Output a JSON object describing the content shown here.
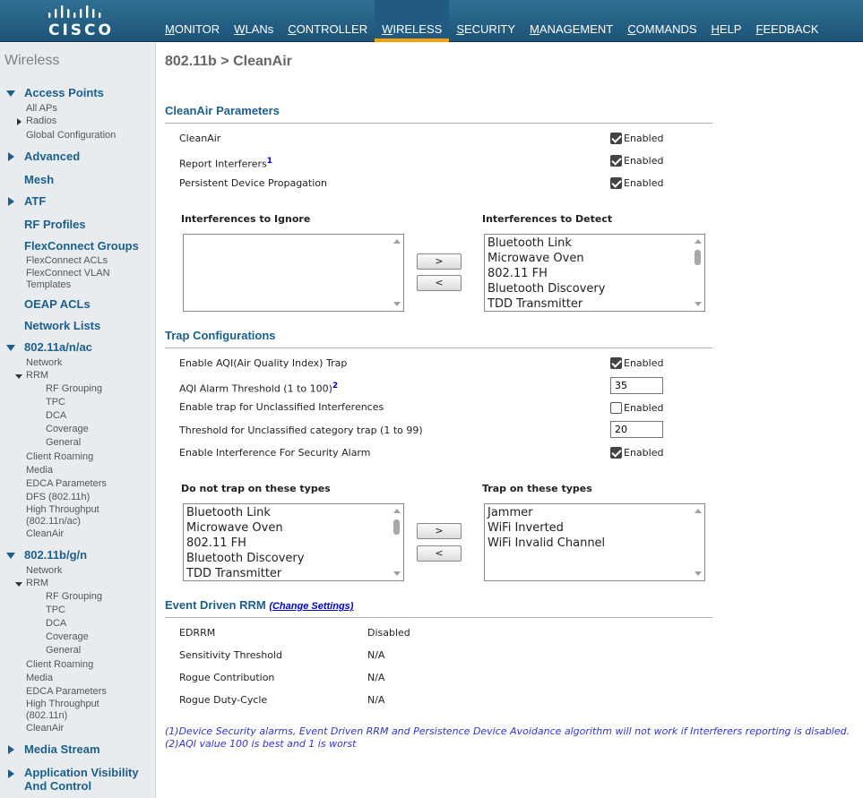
{
  "brand": {
    "logo_text": "CISCO"
  },
  "nav": [
    {
      "id": "monitor",
      "ul": "M",
      "rest": "ONITOR"
    },
    {
      "id": "wlans",
      "ul": "W",
      "rest": "LANs"
    },
    {
      "id": "controller",
      "ul": "C",
      "rest": "ONTROLLER"
    },
    {
      "id": "wireless",
      "ul": "W",
      "rest": "IRELESS"
    },
    {
      "id": "security",
      "ul": "S",
      "rest": "ECURITY"
    },
    {
      "id": "management",
      "ul": "M",
      "rest": "ANAGEMENT"
    },
    {
      "id": "commands",
      "ul": "C",
      "rest": "OMMANDS"
    },
    {
      "id": "help",
      "ul": "H",
      "rest": "ELP"
    },
    {
      "id": "feedback",
      "ul": "F",
      "rest": "EEDBACK"
    }
  ],
  "nav_active": "wireless",
  "sidebar": {
    "title": "Wireless",
    "access_points": "Access Points",
    "all_aps": "All APs",
    "radios": "Radios",
    "global_config": "Global Configuration",
    "advanced": "Advanced",
    "mesh": "Mesh",
    "atf": "ATF",
    "rf_profiles": "RF Profiles",
    "flexconnect_groups": "FlexConnect Groups",
    "flexconnect_acls": "FlexConnect ACLs",
    "flexconnect_vlan_1": "FlexConnect VLAN",
    "flexconnect_vlan_2": "Templates",
    "oeap_acls": "OEAP ACLs",
    "network_lists": "Network Lists",
    "a_band": "802.11a/n/ac",
    "a_network": "Network",
    "a_rrm": "RRM",
    "a_rf_grouping": "RF Grouping",
    "a_tpc": "TPC",
    "a_dca": "DCA",
    "a_coverage": "Coverage",
    "a_general": "General",
    "a_client_roaming": "Client Roaming",
    "a_media": "Media",
    "a_edca": "EDCA Parameters",
    "a_dfs": "DFS (802.11h)",
    "a_ht_1": "High Throughput",
    "a_ht_2": "(802.11n/ac)",
    "a_cleanair": "CleanAir",
    "b_band": "802.11b/g/n",
    "b_network": "Network",
    "b_rrm": "RRM",
    "b_rf_grouping": "RF Grouping",
    "b_tpc": "TPC",
    "b_dca": "DCA",
    "b_coverage": "Coverage",
    "b_general": "General",
    "b_client_roaming": "Client Roaming",
    "b_media": "Media",
    "b_edca": "EDCA Parameters",
    "b_ht_1": "High Throughput",
    "b_ht_2": "(802.11n)",
    "b_cleanair": "CleanAir",
    "media_stream": "Media Stream",
    "avc_1": "Application Visibility",
    "avc_2": "And Control"
  },
  "page": {
    "title": "802.11b > CleanAir"
  },
  "cleanair": {
    "section_title": "CleanAir Parameters",
    "enabled_label": "Enabled",
    "cleanair_label": "CleanAir",
    "cleanair_checked": true,
    "report_interferers_label": "Report Interferers",
    "report_interferers_sup": "1",
    "report_interferers_checked": true,
    "persistent_label": "Persistent Device Propagation",
    "persistent_checked": true,
    "ignore_header": "Interferences to Ignore",
    "detect_header": "Interferences to Detect",
    "ignore_items": [],
    "detect_items": [
      "Bluetooth Link",
      "Microwave Oven",
      "802.11 FH",
      "Bluetooth Discovery",
      "TDD Transmitter"
    ],
    "move_right": ">",
    "move_left": "<"
  },
  "trap": {
    "section_title": "Trap Configurations",
    "aqi_trap_label": "Enable AQI(Air Quality Index) Trap",
    "aqi_trap_checked": true,
    "aqi_threshold_label": "AQI Alarm Threshold (1 to 100)",
    "aqi_threshold_sup": "2",
    "aqi_threshold_value": "35",
    "unclassified_label": "Enable trap for Unclassified Interferences",
    "unclassified_checked": false,
    "unclassified_threshold_label": "Threshold for Unclassified category trap (1 to 99)",
    "unclassified_threshold_value": "20",
    "security_alarm_label": "Enable Interference For Security Alarm",
    "security_alarm_checked": true,
    "no_trap_header": "Do not trap on these types",
    "trap_header": "Trap on these types",
    "no_trap_items": [
      "Bluetooth Link",
      "Microwave Oven",
      "802.11 FH",
      "Bluetooth Discovery",
      "TDD Transmitter"
    ],
    "trap_items": [
      "Jammer",
      "WiFi Inverted",
      "WiFi Invalid Channel"
    ]
  },
  "edrrm": {
    "section_title": "Event Driven RRM",
    "change_settings": "(Change Settings)",
    "rows": [
      {
        "label": "EDRRM",
        "value": "Disabled"
      },
      {
        "label": "Sensitivity Threshold",
        "value": "N/A"
      },
      {
        "label": "Rogue Contribution",
        "value": "N/A"
      },
      {
        "label": "Rogue Duty-Cycle",
        "value": "N/A"
      }
    ]
  },
  "footnotes": [
    "(1)Device Security alarms, Event Driven RRM and Persistence Device Avoidance algorithm will not work if Interferers reporting is disabled.",
    "(2)AQI value 100 is best and 1 is worst"
  ]
}
